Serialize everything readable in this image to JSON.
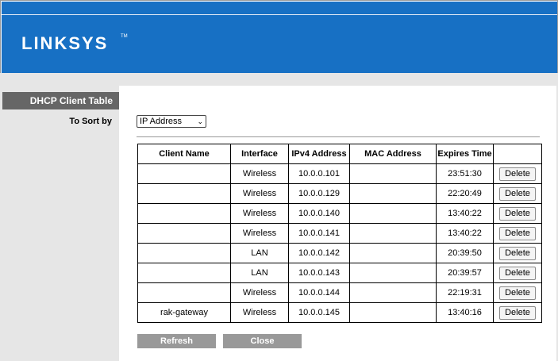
{
  "header": {
    "logo": "LINKSYS",
    "trademark": "TM"
  },
  "section": {
    "title": "DHCP Client Table"
  },
  "sort": {
    "label": "To Sort by",
    "selected": "IP Address",
    "caret": "⌄"
  },
  "table": {
    "columns": [
      "Client Name",
      "Interface",
      "IPv4 Address",
      "MAC Address",
      "Expires Time",
      ""
    ],
    "rows": [
      {
        "client_name": "",
        "interface": "Wireless",
        "ipv4": "10.0.0.101",
        "mac": "",
        "expires": "23:51:30",
        "action": "Delete"
      },
      {
        "client_name": "",
        "interface": "Wireless",
        "ipv4": "10.0.0.129",
        "mac": "",
        "expires": "22:20:49",
        "action": "Delete"
      },
      {
        "client_name": "",
        "interface": "Wireless",
        "ipv4": "10.0.0.140",
        "mac": "",
        "expires": "13:40:22",
        "action": "Delete"
      },
      {
        "client_name": "",
        "interface": "Wireless",
        "ipv4": "10.0.0.141",
        "mac": "",
        "expires": "13:40:22",
        "action": "Delete"
      },
      {
        "client_name": "",
        "interface": "LAN",
        "ipv4": "10.0.0.142",
        "mac": "",
        "expires": "20:39:50",
        "action": "Delete"
      },
      {
        "client_name": "",
        "interface": "LAN",
        "ipv4": "10.0.0.143",
        "mac": "",
        "expires": "20:39:57",
        "action": "Delete"
      },
      {
        "client_name": "",
        "interface": "Wireless",
        "ipv4": "10.0.0.144",
        "mac": "",
        "expires": "22:19:31",
        "action": "Delete"
      },
      {
        "client_name": "rak-gateway",
        "interface": "Wireless",
        "ipv4": "10.0.0.145",
        "mac": "",
        "expires": "13:40:16",
        "action": "Delete"
      }
    ]
  },
  "buttons": {
    "refresh": "Refresh",
    "close": "Close"
  },
  "colors": {
    "header": "#1770c4",
    "section_title_bg": "#666666",
    "button_bg": "#999999",
    "sidebar_bg": "#e6e6e6"
  }
}
